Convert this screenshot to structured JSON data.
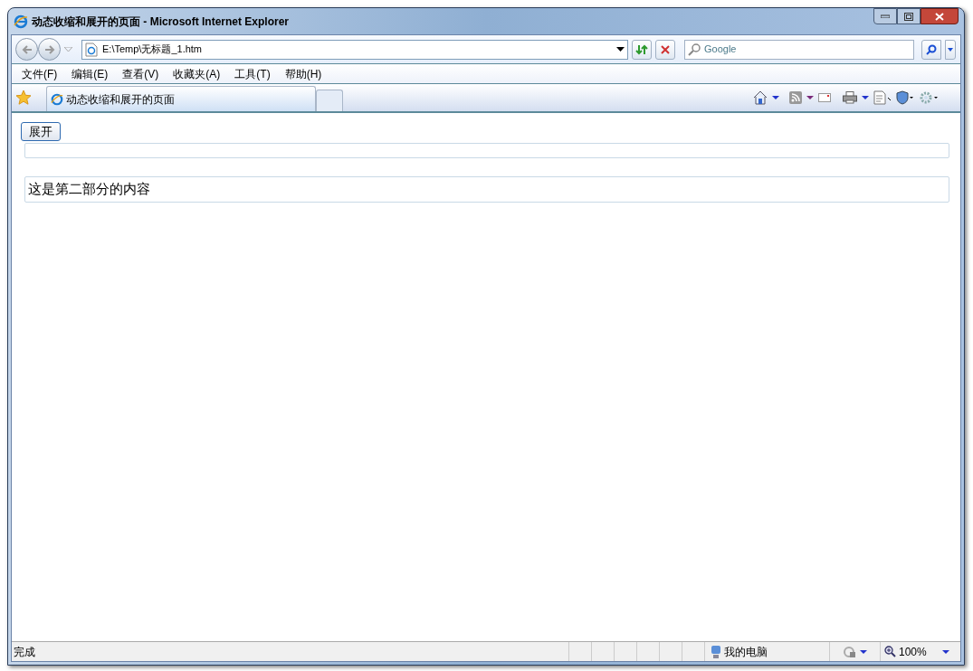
{
  "window": {
    "title": "动态收缩和展开的页面 - Microsoft Internet Explorer"
  },
  "address_bar": {
    "value": "E:\\Temp\\无标题_1.htm"
  },
  "search": {
    "placeholder": "Google"
  },
  "menu": [
    "文件(F)",
    "编辑(E)",
    "查看(V)",
    "收藏夹(A)",
    "工具(T)",
    "帮助(H)"
  ],
  "tabs": [
    {
      "label": "动态收缩和展开的页面",
      "selected": true
    }
  ],
  "page": {
    "toggle_button": "展开",
    "sections": [
      {
        "kind": "collapsed"
      },
      {
        "kind": "text",
        "text": "这是第二部分的内容"
      }
    ]
  },
  "status_bar": {
    "text": "完成",
    "zone": "我的电脑",
    "zoom": "100%"
  }
}
